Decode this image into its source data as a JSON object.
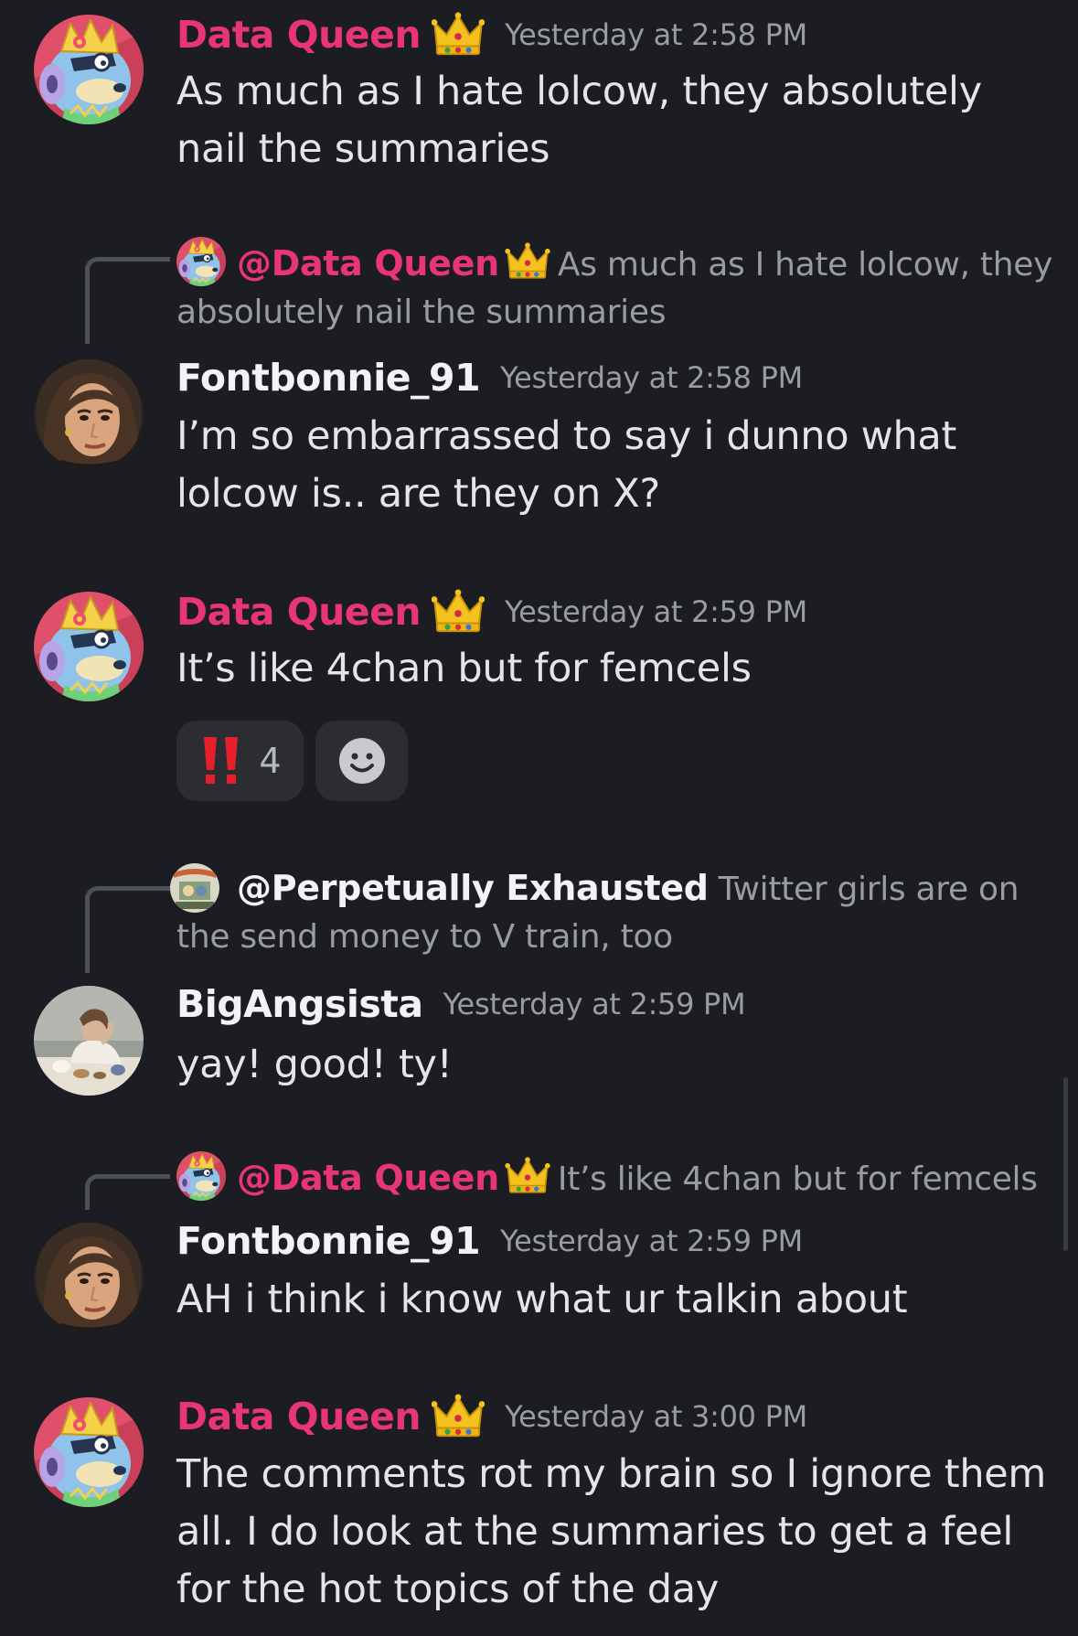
{
  "colors": {
    "background": "#1c1d22",
    "role_name": "#e8357a",
    "timestamp": "#9a9ca4",
    "reply_text": "#9a9ca4",
    "message_text": "#e4e5e8"
  },
  "messages": [
    {
      "author": "Data Queen",
      "badge": "crown-emoji",
      "timestamp": "Yesterday at 2:58 PM",
      "text": "As much as I hate lolcow, they absolutely nail the summaries"
    },
    {
      "reply": {
        "mention": "@Data Queen",
        "badge": "crown-emoji",
        "text": "As much as I hate lolcow, they absolutely nail the summaries"
      },
      "author": "Fontbonnie_91",
      "timestamp": "Yesterday at 2:58 PM",
      "text": "I’m so embarrassed to say i dunno what lolcow is.. are they on X?"
    },
    {
      "author": "Data Queen",
      "badge": "crown-emoji",
      "timestamp": "Yesterday at 2:59 PM",
      "text": "It’s like 4chan but for femcels",
      "reactions": [
        {
          "emoji": "double-exclamation-icon",
          "count": "4"
        },
        {
          "emoji": "add-reaction-icon"
        }
      ]
    },
    {
      "reply": {
        "mention": "@Perpetually Exhausted",
        "text": "Twitter girls are on the send money to V train, too"
      },
      "author": "BigAngsista",
      "timestamp": "Yesterday at 2:59 PM",
      "text": "yay! good! ty!"
    },
    {
      "reply": {
        "mention": "@Data Queen",
        "badge": "crown-emoji",
        "text": "It’s like 4chan but for femcels"
      },
      "author": "Fontbonnie_91",
      "timestamp": "Yesterday at 2:59 PM",
      "text": "AH i think i know what ur talkin about"
    },
    {
      "author": "Data Queen",
      "badge": "crown-emoji",
      "timestamp": "Yesterday at 3:00 PM",
      "text": "The comments rot my brain so I ignore them all. I do look at the summaries to get a feel for the hot topics of the day"
    }
  ]
}
